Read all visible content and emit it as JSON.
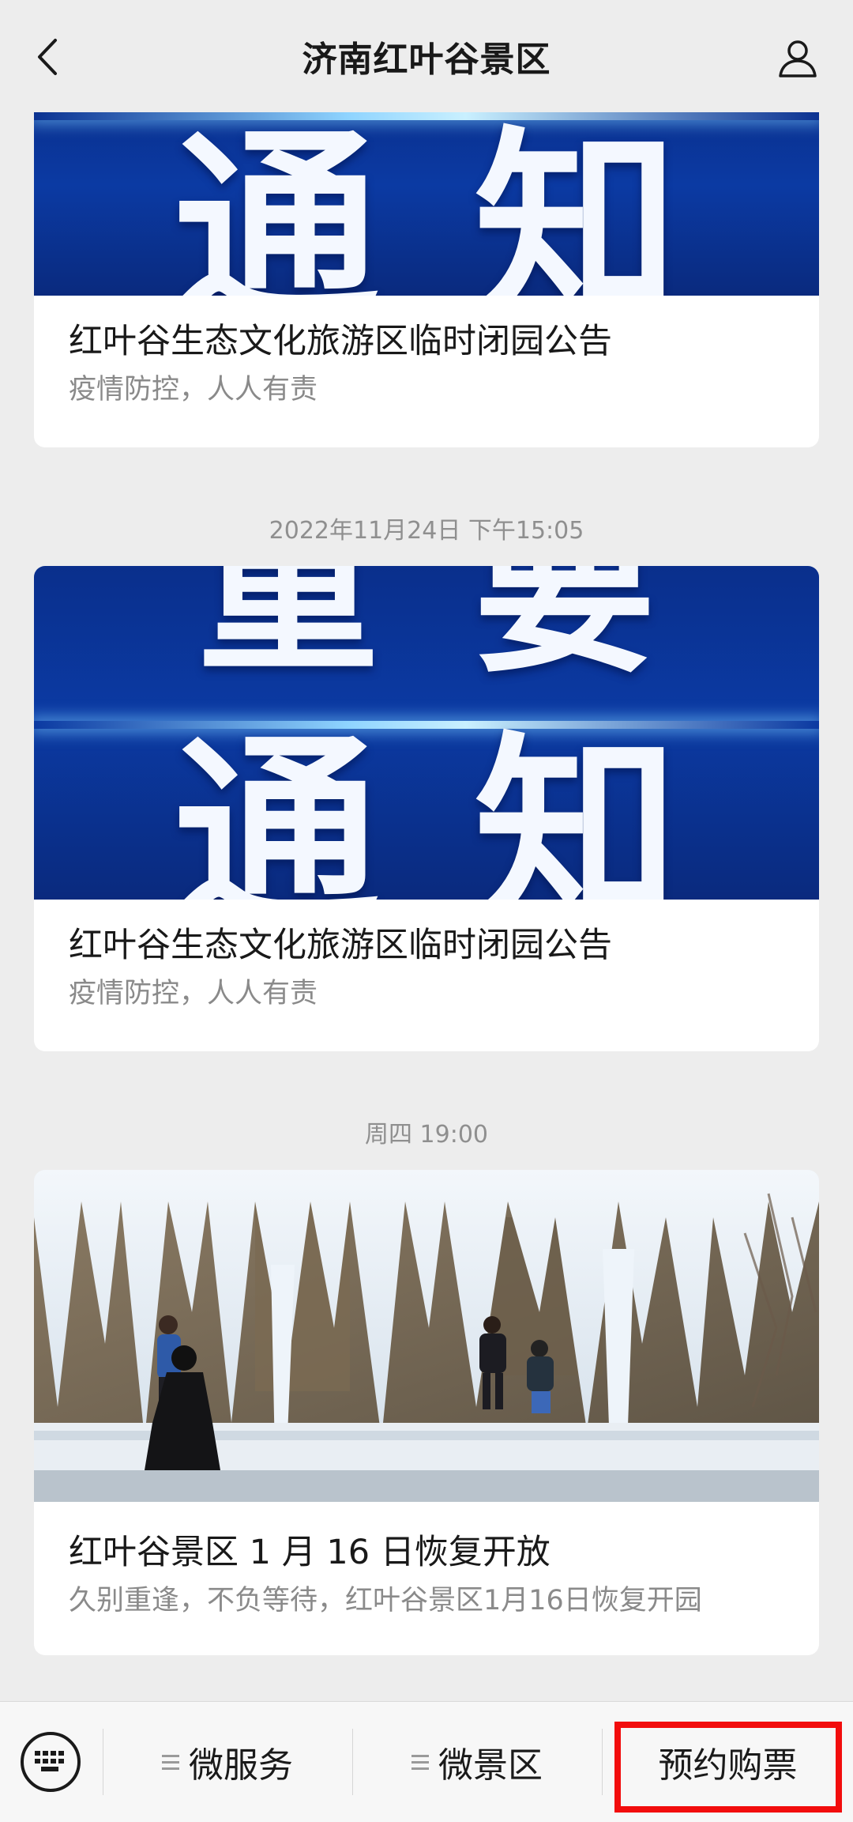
{
  "header": {
    "title": "济南红叶谷景区",
    "back_icon": "chevron-left-icon",
    "user_icon": "user-icon"
  },
  "feed": {
    "cards": [
      {
        "cover_text_lines": [
          "通知"
        ],
        "title": "红叶谷生态文化旅游区临时闭园公告",
        "desc": "疫情防控，人人有责"
      },
      {
        "timestamp": "2022年11月24日 下午15:05",
        "cover_text_lines": [
          "重要",
          "通知"
        ],
        "title": "红叶谷生态文化旅游区临时闭园公告",
        "desc": "疫情防控，人人有责"
      },
      {
        "timestamp": "周四 19:00",
        "cover_description": "冰瀑布与游客",
        "title": "红叶谷景区 1 月 16 日恢复开放",
        "desc": "久别重逢，不负等待，红叶谷景区1月16日恢复开园"
      }
    ]
  },
  "bottom_menu": {
    "keyboard_icon": "keyboard-icon",
    "items": [
      {
        "label": "微服务",
        "has_submenu": true
      },
      {
        "label": "微景区",
        "has_submenu": true
      },
      {
        "label": "预约购票",
        "has_submenu": false
      }
    ],
    "highlight_color": "#f20d0d"
  }
}
